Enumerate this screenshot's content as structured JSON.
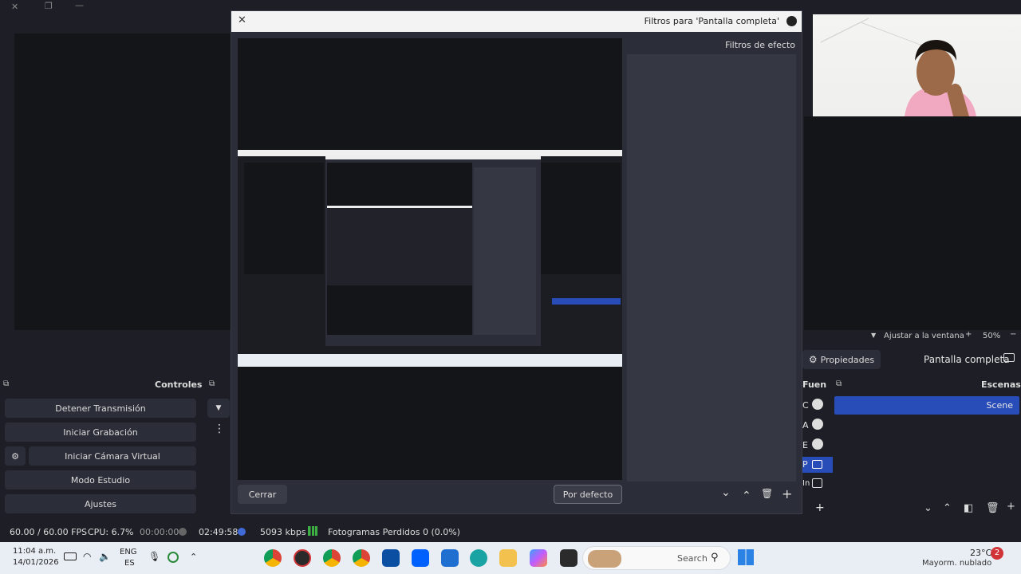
{
  "dialog": {
    "title": "Filtros para 'Pantalla completa'",
    "effects_label": "Filtros de efecto",
    "close_button": "Cerrar",
    "defaults_button": "Por defecto"
  },
  "preview_bar": {
    "zoom": "50%",
    "fit_label": "Ajustar a la ventana"
  },
  "source_bar": {
    "source_name": "Pantalla completa",
    "properties_label": "Propiedades"
  },
  "docks": {
    "scenes_title": "Escenas",
    "sources_title": "Fuen",
    "controls_title": "Controles",
    "scenes": [
      "Scene"
    ],
    "source_letters": [
      "C",
      "A",
      "E",
      "P",
      "In"
    ]
  },
  "controls": {
    "stop_stream": "Detener Transmisión",
    "start_record": "Iniciar Grabación",
    "start_vcam": "Iniciar Cámara Virtual",
    "studio_mode": "Modo Estudio",
    "settings": "Ajustes"
  },
  "statusbar": {
    "dropped": "Fotogramas Perdidos 0 (0.0%)",
    "bitrate": "5093 kbps",
    "stream_time": "02:49:58",
    "rec_time": "00:00:00",
    "cpu": "CPU: 6.7%",
    "fps": "60.00 / 60.00 FPS"
  },
  "taskbar": {
    "weather_temp": "23°C",
    "weather_desc": "Mayorm. nublado",
    "search": "Search",
    "lang": "ENG",
    "lang2": "ES",
    "time": "11:04 a.m.",
    "date": "14/01/2026",
    "notif_count": "2"
  },
  "colors": {
    "accent": "#284cb8",
    "dialog_bg": "#2b2e38",
    "window_bg": "#1e1f26"
  }
}
